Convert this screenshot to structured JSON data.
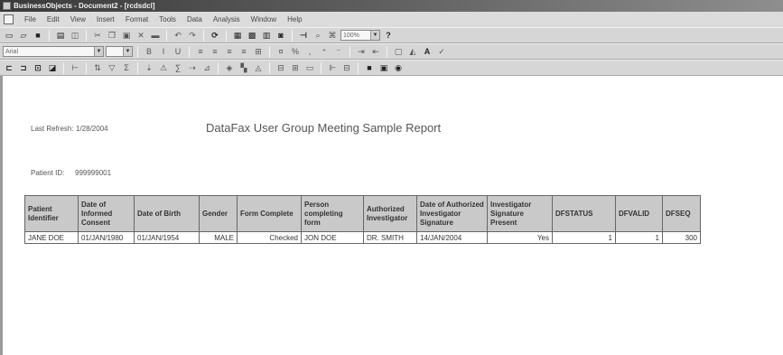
{
  "window": {
    "title": "BusinessObjects - Document2 - [rcdsdcl]"
  },
  "menu": [
    "File",
    "Edit",
    "View",
    "Insert",
    "Format",
    "Tools",
    "Data",
    "Analysis",
    "Window",
    "Help"
  ],
  "toolbar": {
    "zoom": "100%",
    "font_name": "Arial"
  },
  "report": {
    "last_refresh_label": "Last Refresh:",
    "last_refresh_value": "1/28/2004",
    "title": "DataFax User Group Meeting Sample Report",
    "patient_id_label": "Patient ID:",
    "patient_id_value": "999999001",
    "columns": [
      "Patient Identifier",
      "Date of Informed Consent",
      "Date of Birth",
      "Gender",
      "Form Complete",
      "Person completing form",
      "Authorized Investigator",
      "Date of Authorized Investigator Signature",
      "Investigator Signature Present",
      "DFSTATUS",
      "DFVALID",
      "DFSEQ"
    ],
    "row": [
      "JANE DOE",
      "01/JAN/1980",
      "01/JAN/1954",
      "MALE",
      "Checked",
      "JON DOE",
      "DR. SMITH",
      "14/JAN/2004",
      "Yes",
      "1",
      "1",
      "300"
    ]
  }
}
